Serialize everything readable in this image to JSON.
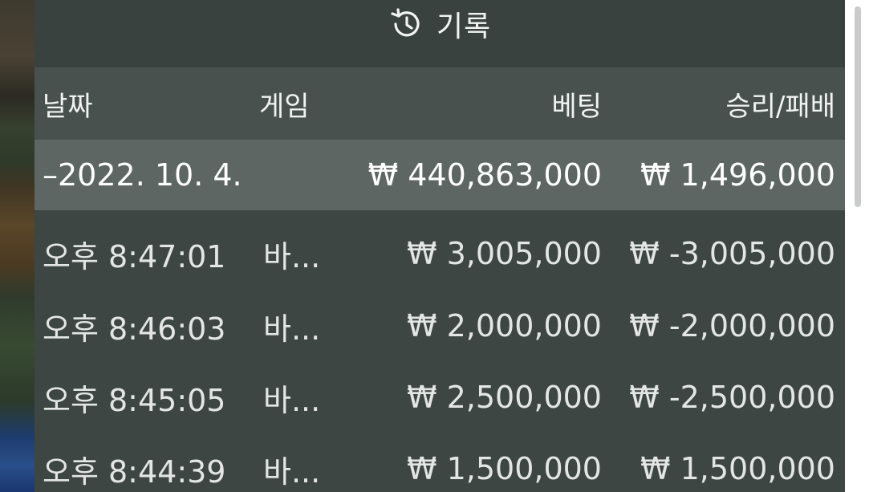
{
  "panel": {
    "title": "기록",
    "title_icon": "history-icon"
  },
  "columns": {
    "date": "날짜",
    "game": "게임",
    "bet": "베팅",
    "result": "승리/패배"
  },
  "date_group": {
    "date": "–2022. 10. 4.",
    "bet_total": "₩ 440,863,000",
    "result_total": "₩ 1,496,000"
  },
  "rows": [
    {
      "time": "오후 8:47:01",
      "game": "바...",
      "bet": "₩ 3,005,000",
      "result": "₩ -3,005,000"
    },
    {
      "time": "오후 8:46:03",
      "game": "바...",
      "bet": "₩ 2,000,000",
      "result": "₩ -2,000,000"
    },
    {
      "time": "오후 8:45:05",
      "game": "바...",
      "bet": "₩ 2,500,000",
      "result": "₩ -2,500,000"
    },
    {
      "time": "오후 8:44:39",
      "game": "바...",
      "bet": "₩ 1,500,000",
      "result": "₩ 1,500,000"
    }
  ]
}
